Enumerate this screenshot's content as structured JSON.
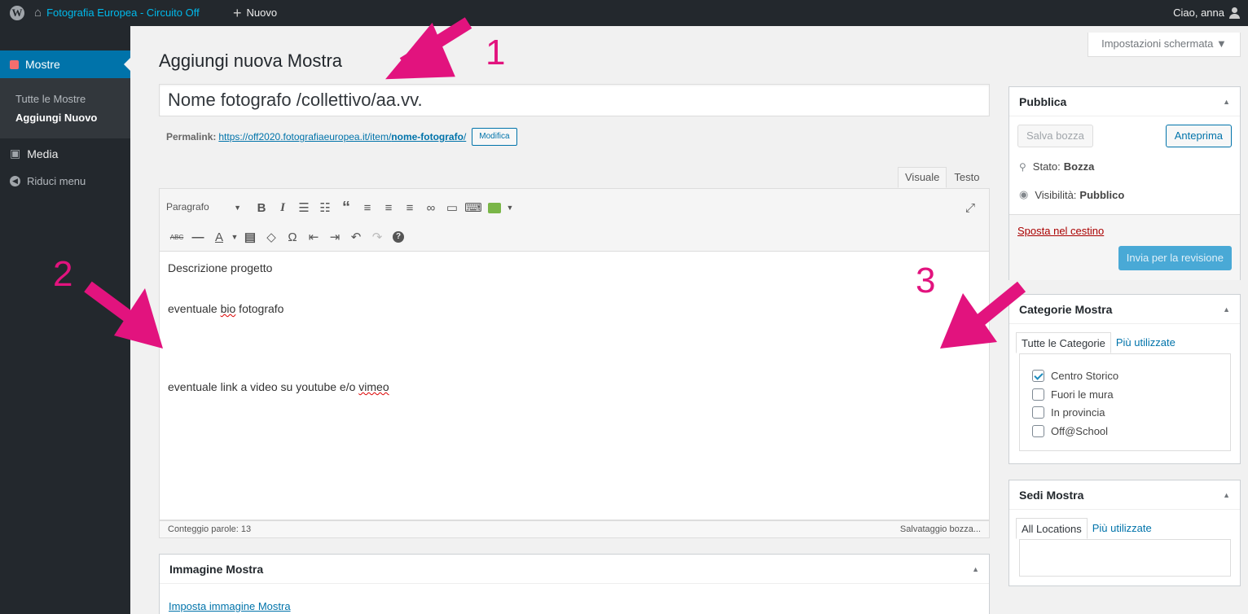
{
  "adminbar": {
    "site_name": "Fotografia Europea - Circuito Off",
    "new_label": "Nuovo",
    "greeting": "Ciao, anna"
  },
  "sidebar": {
    "current_label": "Mostre",
    "sub_items": [
      "Tutte le Mostre",
      "Aggiungi Nuovo"
    ],
    "media_label": "Media",
    "collapse_label": "Riduci menu"
  },
  "screen_options": "Impostazioni schermata ▼",
  "page_title": "Aggiungi nuova Mostra",
  "post_title": "Nome fotografo /collettivo/aa.vv.",
  "permalink": {
    "label": "Permalink:",
    "url_base": "https://off2020.fotografiaeuropea.it/item/",
    "slug": "nome-fotografo",
    "url_end": "/",
    "edit_label": "Modifica"
  },
  "editor": {
    "tab_visual": "Visuale",
    "tab_text": "Testo",
    "format_select": "Paragrafo",
    "lines": {
      "l1": "Descrizione progetto",
      "l2a": "eventuale ",
      "l2b": "bio",
      "l2c": " fotografo",
      "l3a": "eventuale link a video su youtube e/o ",
      "l3b": "vimeo"
    },
    "word_count": "Conteggio parole: 13",
    "draft_status": "Salvataggio bozza..."
  },
  "publish": {
    "title": "Pubblica",
    "save_draft": "Salva bozza",
    "preview": "Anteprima",
    "status_label": "Stato:",
    "status_value": "Bozza",
    "visibility_label": "Visibilità:",
    "visibility_value": "Pubblico",
    "trash": "Sposta nel cestino",
    "submit": "Invia per la revisione"
  },
  "categories": {
    "title": "Categorie Mostra",
    "tab_all": "Tutte le Categorie",
    "tab_popular": "Più utilizzate",
    "items": [
      {
        "label": "Centro Storico",
        "checked": true
      },
      {
        "label": "Fuori le mura",
        "checked": false
      },
      {
        "label": "In provincia",
        "checked": false
      },
      {
        "label": "Off@School",
        "checked": false
      }
    ]
  },
  "locations": {
    "title": "Sedi Mostra",
    "tab_all": "All Locations",
    "tab_popular": "Più utilizzate"
  },
  "featured_image": {
    "title": "Immagine Mostra",
    "link": "Imposta immagine Mostra"
  },
  "annotations": [
    "1",
    "2",
    "3"
  ],
  "colors": {
    "accent": "#0073aa",
    "annotation": "#e2137e",
    "adminbar": "#23282d"
  }
}
